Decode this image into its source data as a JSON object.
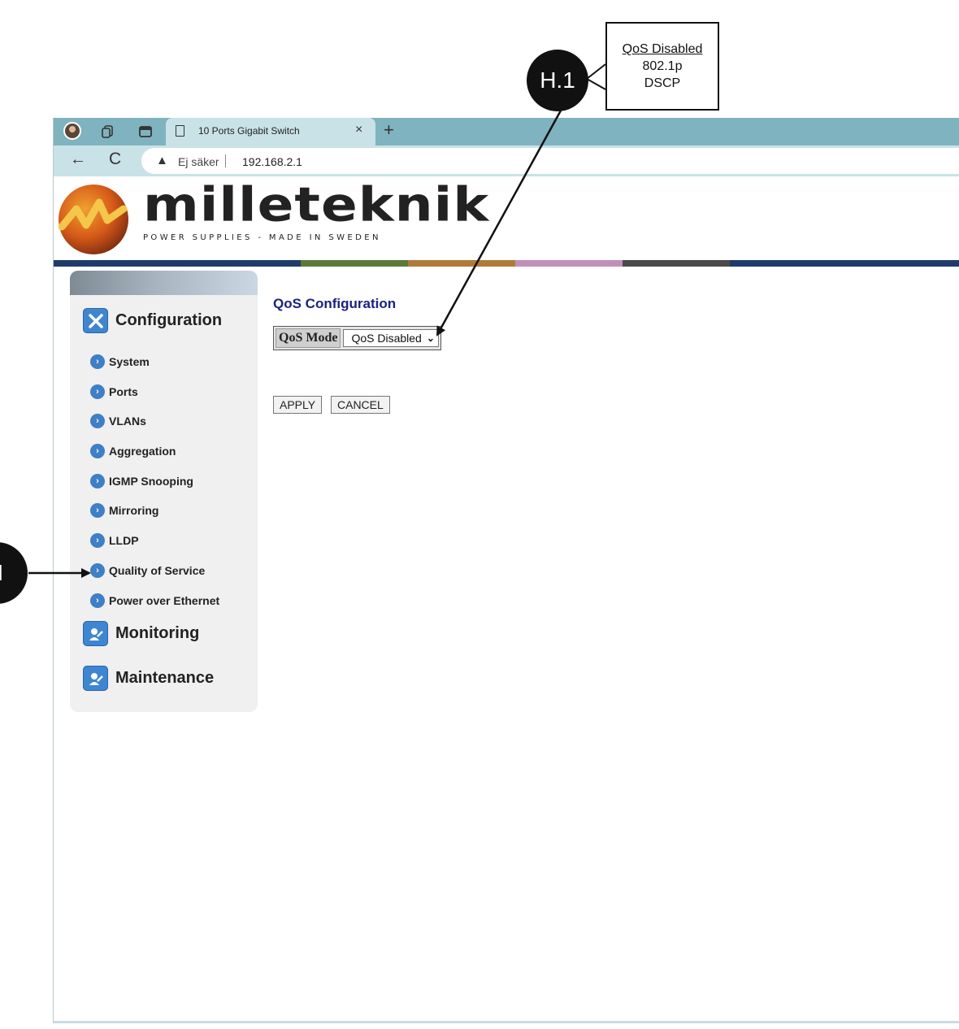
{
  "browser": {
    "tab_title": "10 Ports Gigabit Switch",
    "tab_close": "×",
    "new_tab": "+",
    "back": "←",
    "reload": "C",
    "warning_icon": "warning-triangle-icon",
    "security_text": "Ej säker",
    "url": "192.168.2.1"
  },
  "header": {
    "logo_word": "milleteknik",
    "logo_tagline": "POWER SUPPLIES - MADE IN SWEDEN",
    "stripe_colors": [
      "#1f3b6b",
      "#5b7a3a",
      "#b07a38",
      "#c28fb9",
      "#4a4a4a",
      "#1f3b6b"
    ]
  },
  "sidebar": {
    "configuration": "Configuration",
    "items": [
      {
        "label": "System"
      },
      {
        "label": "Ports"
      },
      {
        "label": "VLANs"
      },
      {
        "label": "Aggregation"
      },
      {
        "label": "IGMP Snooping"
      },
      {
        "label": "Mirroring"
      },
      {
        "label": "LLDP"
      },
      {
        "label": "Quality of Service"
      },
      {
        "label": "Power over Ethernet"
      }
    ],
    "monitoring": "Monitoring",
    "maintenance": "Maintenance"
  },
  "main": {
    "title": "QoS Configuration",
    "qos_mode_label": "QoS Mode",
    "qos_mode_value": "QoS Disabled",
    "apply": "APPLY",
    "cancel": "CANCEL"
  },
  "annotations": {
    "marker_h1": "H.1",
    "marker_left": "H",
    "callout_options": [
      "QoS Disabled",
      "802.1p",
      "DSCP"
    ]
  },
  "colors": {
    "accent": "#1a237e",
    "tabbar": "#7fb3bf",
    "addrbar": "#c9e2e7",
    "menu_bullet": "#3e7fc6"
  }
}
